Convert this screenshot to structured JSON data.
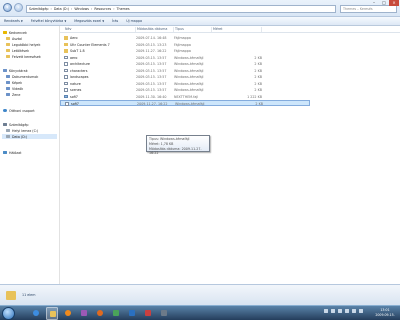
{
  "address": {
    "crumbs": [
      "Számítógép",
      "Data (D:)",
      "Windows",
      "Resources",
      "Themes"
    ],
    "search_placeholder": "Themes – Keresés"
  },
  "toolbar": {
    "organize": "Rendezés",
    "include_library": "Felvétel könyvtárba",
    "share": "Megosztás ezzel",
    "burn": "Írás",
    "new_folder": "Új mappa"
  },
  "sidebar": {
    "items": [
      {
        "label": "Kedvencek",
        "icon": "star"
      },
      {
        "label": "Asztal",
        "icon": "folder"
      },
      {
        "label": "Legutóbbi helyek",
        "icon": "folder"
      },
      {
        "label": "Letöltések",
        "icon": "folder"
      },
      {
        "label": "Felvett keresések",
        "icon": "folder"
      },
      {
        "label": "Könyvtárak",
        "icon": "lib"
      },
      {
        "label": "Dokumentumok",
        "icon": "lib"
      },
      {
        "label": "Képek",
        "icon": "lib"
      },
      {
        "label": "Videók",
        "icon": "lib"
      },
      {
        "label": "Zene",
        "icon": "lib"
      },
      {
        "label": "Otthoni csoport",
        "icon": "home"
      },
      {
        "label": "Számítógép",
        "icon": "pc"
      },
      {
        "label": "Helyi lemez (C:)",
        "icon": "drive"
      },
      {
        "label": "Data (D:)",
        "icon": "drive"
      },
      {
        "label": "Hálózat",
        "icon": "net"
      }
    ]
  },
  "columns": {
    "name": "Név",
    "date": "Módosítás dátuma",
    "type": "Típus",
    "size": "Méret"
  },
  "files": [
    {
      "name": "Aero",
      "date": "2009.07.14. 16:48",
      "type": "Fájlmappa",
      "size": "",
      "kind": "dir"
    },
    {
      "name": "Ultr Counter Elements 7",
      "date": "2009.03.15. 13:23",
      "type": "Fájlmappa",
      "size": "",
      "kind": "dir"
    },
    {
      "name": "SubT 1.8",
      "date": "2009.11.27. 16:22",
      "type": "Fájlmappa",
      "size": "",
      "kind": "dir"
    },
    {
      "name": "aero",
      "date": "2009.03.15. 13:57",
      "type": "Windows-témafájl",
      "size": "2 KB",
      "kind": "theme"
    },
    {
      "name": "architecture",
      "date": "2009.03.15. 13:57",
      "type": "Windows-témafájl",
      "size": "2 KB",
      "kind": "theme"
    },
    {
      "name": "characters",
      "date": "2009.03.15. 13:57",
      "type": "Windows-témafájl",
      "size": "2 KB",
      "kind": "theme"
    },
    {
      "name": "landscapes",
      "date": "2009.03.15. 13:57",
      "type": "Windows-témafájl",
      "size": "2 KB",
      "kind": "theme"
    },
    {
      "name": "nature",
      "date": "2009.03.15. 13:57",
      "type": "Windows-témafájl",
      "size": "2 KB",
      "kind": "theme"
    },
    {
      "name": "scenes",
      "date": "2009.03.15. 13:57",
      "type": "Windows-témafájl",
      "size": "2 KB",
      "kind": "theme"
    },
    {
      "name": "sofi7",
      "date": "2009.11.30. 16:40",
      "type": "NEXTTHEM.fajl",
      "size": "1 222 KB",
      "kind": "img"
    },
    {
      "name": "sofi7",
      "date": "2009.11.27. 16:22",
      "type": "Windows-témafájl",
      "size": "2 KB",
      "kind": "theme"
    }
  ],
  "tooltip": {
    "type_line": "Típus: Windows-témafájl",
    "size_line": "Méret: 1,78 KB",
    "date_line": "Módosítás dátuma: 2009.11.27. 16:22"
  },
  "details": {
    "count": "11 elem"
  },
  "clock": {
    "time": "13:01",
    "date": "2009.09.15."
  },
  "colors": {
    "selection": "#cde6fb",
    "taskbar": "#2f4d6e",
    "folder": "#e8c25a"
  }
}
